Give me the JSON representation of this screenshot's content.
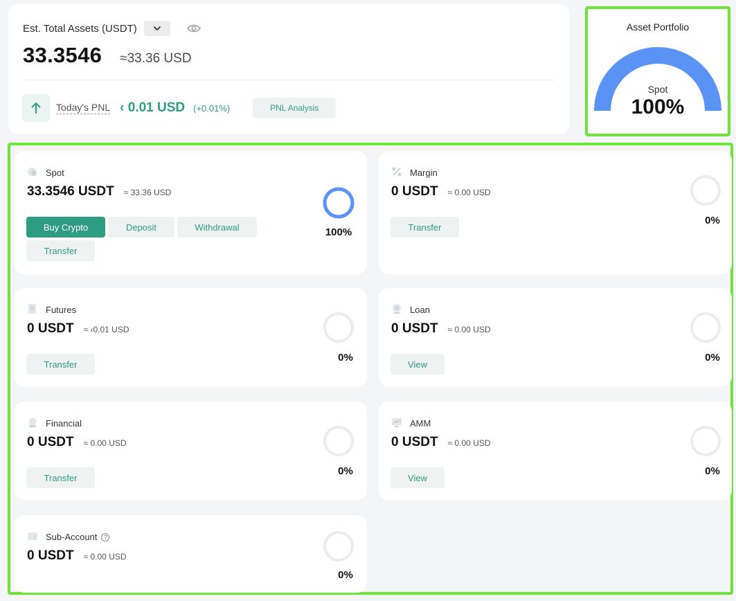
{
  "summary": {
    "label": "Est. Total Assets (USDT)",
    "total": "33.3546",
    "approx": "≈33.36 USD",
    "pnl_label": "Today's PNL",
    "pnl_value": "‹ 0.01 USD",
    "pnl_pct": "(+0.01%)",
    "pnl_button": "PNL Analysis"
  },
  "portfolio": {
    "title": "Asset Portfolio",
    "segment_label": "Spot",
    "segment_value": "100%",
    "spot_fraction": 1.0,
    "color": "#5b93f5"
  },
  "accounts": {
    "spot": {
      "name": "Spot",
      "amount": "33.3546 USDT",
      "approx": "≈ 33.36 USD",
      "pct": "100%",
      "share": 1.0,
      "buttons": [
        "Buy Crypto",
        "Deposit",
        "Withdrawal",
        "Transfer"
      ]
    },
    "margin": {
      "name": "Margin",
      "amount": "0 USDT",
      "approx": "≈ 0.00 USD",
      "pct": "0%",
      "share": 0,
      "buttons": [
        "Transfer"
      ]
    },
    "futures": {
      "name": "Futures",
      "amount": "0 USDT",
      "approx": "≈ ‹0.01 USD",
      "pct": "0%",
      "share": 0,
      "buttons": [
        "Transfer"
      ]
    },
    "loan": {
      "name": "Loan",
      "amount": "0 USDT",
      "approx": "≈ 0.00 USD",
      "pct": "0%",
      "share": 0,
      "buttons": [
        "View"
      ]
    },
    "financial": {
      "name": "Financial",
      "amount": "0 USDT",
      "approx": "≈ 0.00 USD",
      "pct": "0%",
      "share": 0,
      "buttons": [
        "Transfer"
      ]
    },
    "amm": {
      "name": "AMM",
      "amount": "0 USDT",
      "approx": "≈ 0.00 USD",
      "pct": "0%",
      "share": 0,
      "buttons": [
        "View"
      ]
    },
    "subaccount": {
      "name": "Sub-Account",
      "amount": "0 USDT",
      "approx": "≈ 0.00 USD",
      "pct": "0%",
      "share": 0
    }
  },
  "colors": {
    "accent": "#2e9c82",
    "ring_active": "#5b93f5",
    "ring_empty": "#ececec",
    "highlight": "#6ee43a"
  }
}
